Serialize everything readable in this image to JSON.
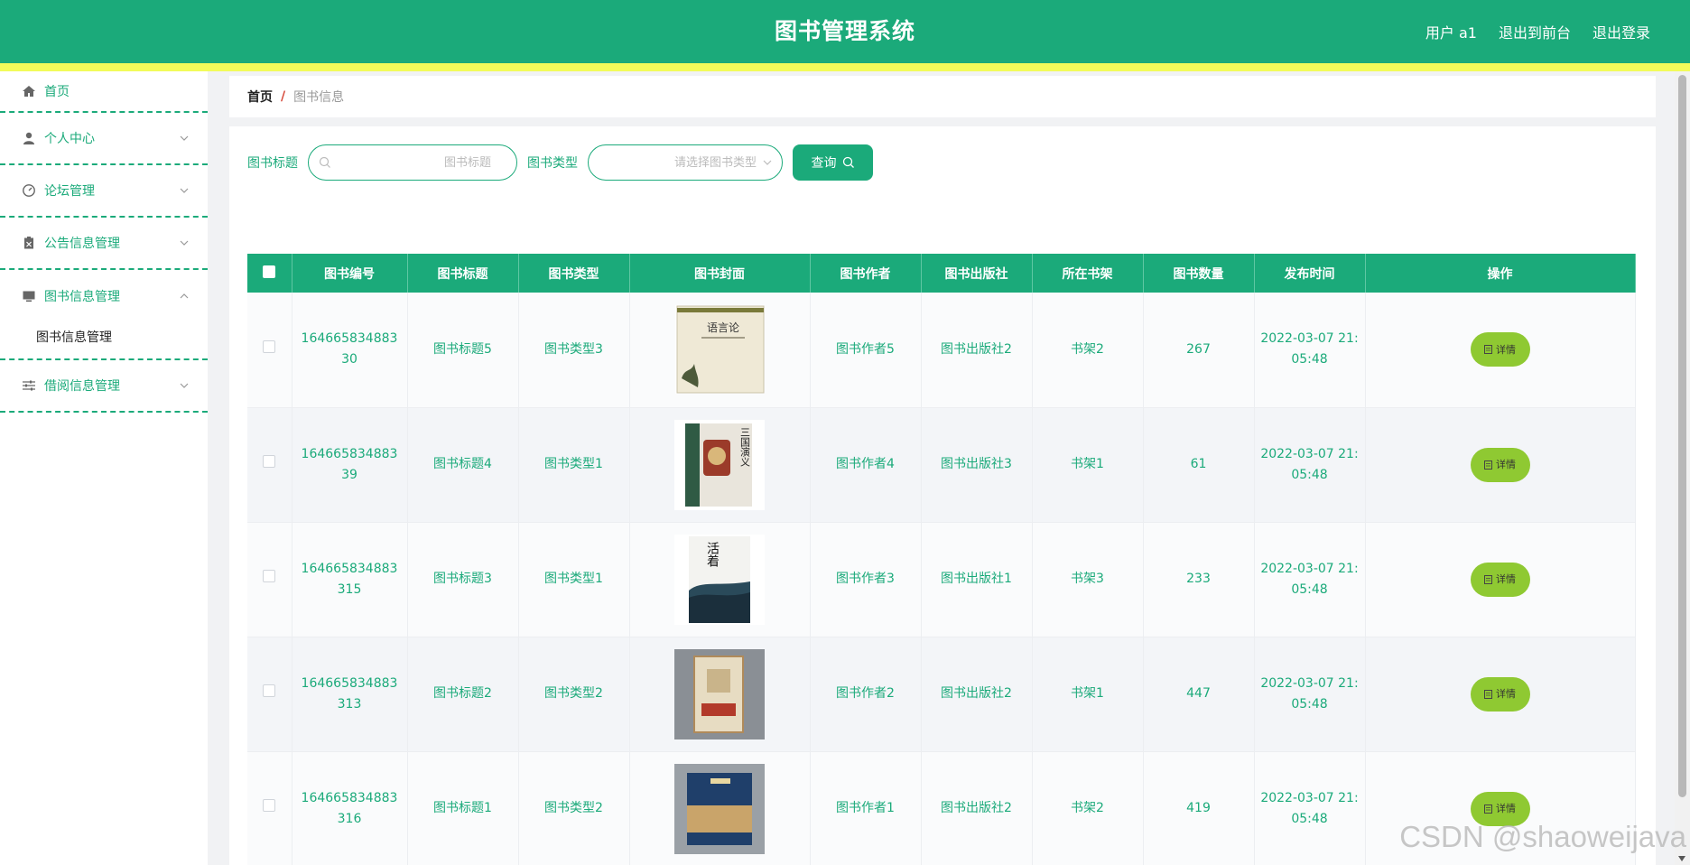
{
  "header": {
    "title": "图书管理系统",
    "user": "用户 a1",
    "to_frontend": "退出到前台",
    "logout": "退出登录"
  },
  "sidebar": {
    "items": [
      {
        "label": "首页",
        "icon": "home-icon"
      },
      {
        "label": "个人中心",
        "icon": "user-icon"
      },
      {
        "label": "论坛管理",
        "icon": "dashboard-icon"
      },
      {
        "label": "公告信息管理",
        "icon": "clipboard-icon"
      },
      {
        "label": "图书信息管理",
        "icon": "monitor-icon",
        "sub": "图书信息管理"
      },
      {
        "label": "借阅信息管理",
        "icon": "sliders-icon"
      }
    ]
  },
  "breadcrumb": {
    "home": "首页",
    "separator": "/",
    "current": "图书信息"
  },
  "search": {
    "title_label": "图书标题",
    "title_placeholder": "图书标题",
    "type_label": "图书类型",
    "type_placeholder": "请选择图书类型",
    "query_label": "查询"
  },
  "table": {
    "headers": [
      "图书编号",
      "图书标题",
      "图书类型",
      "图书封面",
      "图书作者",
      "图书出版社",
      "所在书架",
      "图书数量",
      "发布时间",
      "操作"
    ],
    "detail_label": "详情",
    "rows": [
      {
        "id_line1": "164665834883",
        "id_line2": "30",
        "title": "图书标题5",
        "type": "图书类型3",
        "author": "图书作者5",
        "publisher": "图书出版社2",
        "shelf": "书架2",
        "count": "267",
        "date_line1": "2022-03-07 21:",
        "date_line2": "05:48",
        "cover_text": "语言论"
      },
      {
        "id_line1": "164665834883",
        "id_line2": "39",
        "title": "图书标题4",
        "type": "图书类型1",
        "author": "图书作者4",
        "publisher": "图书出版社3",
        "shelf": "书架1",
        "count": "61",
        "date_line1": "2022-03-07 21:",
        "date_line2": "05:48",
        "cover_text": "三国演义"
      },
      {
        "id_line1": "164665834883",
        "id_line2": "315",
        "title": "图书标题3",
        "type": "图书类型1",
        "author": "图书作者3",
        "publisher": "图书出版社1",
        "shelf": "书架3",
        "count": "233",
        "date_line1": "2022-03-07 21:",
        "date_line2": "05:48",
        "cover_text": "活着"
      },
      {
        "id_line1": "164665834883",
        "id_line2": "313",
        "title": "图书标题2",
        "type": "图书类型2",
        "author": "图书作者2",
        "publisher": "图书出版社2",
        "shelf": "书架1",
        "count": "447",
        "date_line1": "2022-03-07 21:",
        "date_line2": "05:48",
        "cover_text": ""
      },
      {
        "id_line1": "164665834883",
        "id_line2": "316",
        "title": "图书标题1",
        "type": "图书类型2",
        "author": "图书作者1",
        "publisher": "图书出版社2",
        "shelf": "书架2",
        "count": "419",
        "date_line1": "2022-03-07 21:",
        "date_line2": "05:48",
        "cover_text": ""
      }
    ]
  },
  "watermark": "CSDN @shaoweijava",
  "colors": {
    "primary": "#1baa7a",
    "accent_stripe": "#f2fb5a",
    "detail_button": "#8fc932"
  }
}
